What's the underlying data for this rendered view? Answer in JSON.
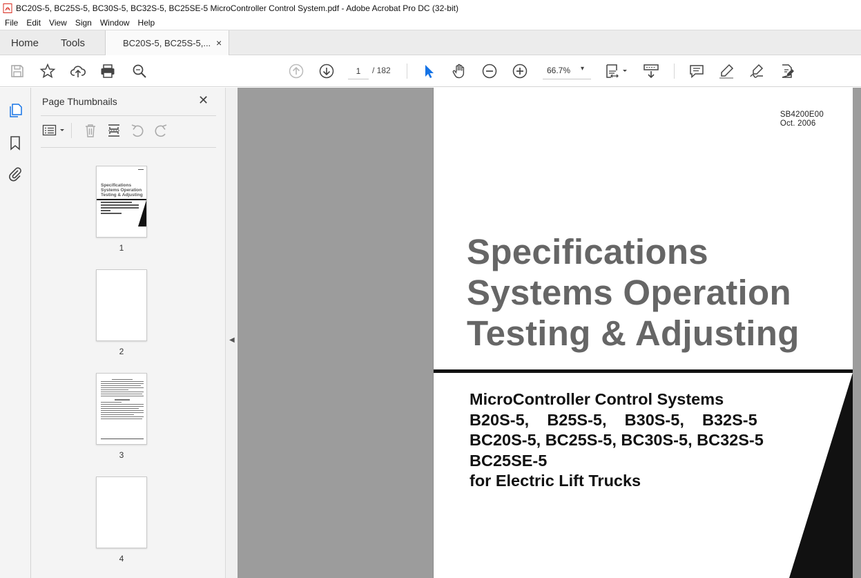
{
  "window": {
    "title": "BC20S-5, BC25S-5, BC30S-5, BC32S-5, BC25SE-5 MicroController Control System.pdf - Adobe Acrobat Pro DC (32-bit)"
  },
  "menu": {
    "items": [
      "File",
      "Edit",
      "View",
      "Sign",
      "Window",
      "Help"
    ]
  },
  "tabs": {
    "home": "Home",
    "tools": "Tools",
    "document": "BC20S-5, BC25S-5,...",
    "close": "×"
  },
  "toolbar": {
    "current_page": "1",
    "page_total": "/  182",
    "zoom": "66.7%",
    "zoom_caret": "▾"
  },
  "thumbnail_panel": {
    "title": "Page Thumbnails",
    "close": "✕",
    "pages": [
      {
        "label": "1"
      },
      {
        "label": "2"
      },
      {
        "label": "3"
      },
      {
        "label": "4"
      }
    ],
    "thumb1_title": [
      "Specifications",
      "Systems Operation",
      "Testing & Adjusting"
    ]
  },
  "document": {
    "code": "SB4200E00",
    "date": "Oct. 2006",
    "title_lines": [
      "Specifications",
      "Systems Operation",
      "Testing & Adjusting"
    ],
    "subtitle_lines": [
      "MicroController Control Systems",
      "B20S-5,    B25S-5,    B30S-5,    B32S-5",
      "BC20S-5, BC25S-5, BC30S-5, BC32S-5",
      "BC25SE-5",
      "for Electric Lift Trucks"
    ]
  },
  "colors": {
    "accent_blue": "#1473e6",
    "title_gray": "#666666",
    "acrobat_red": "#d7281c"
  }
}
